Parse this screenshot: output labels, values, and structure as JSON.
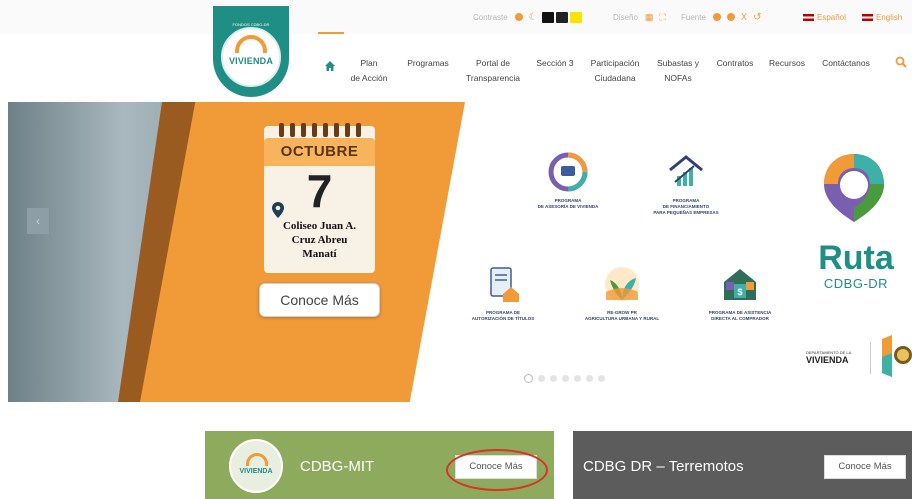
{
  "utility_bar": {
    "contrast_label": "Contraste",
    "design_label": "Diseño",
    "font_label": "Fuente",
    "spanish": "Español",
    "english": "English"
  },
  "logo": {
    "top_text": "FONDOS CDBG-DR",
    "word": "VIVIENDA"
  },
  "nav": {
    "items": [
      {
        "line1": "Plan",
        "line2": "de Acción"
      },
      {
        "line1": "Programas",
        "line2": ""
      },
      {
        "line1": "Portal de",
        "line2": "Transparencia"
      },
      {
        "line1": "Sección 3",
        "line2": ""
      },
      {
        "line1": "Participación",
        "line2": "Ciudadana"
      },
      {
        "line1": "Subastas y",
        "line2": "NOFAs"
      },
      {
        "line1": "Contratos",
        "line2": ""
      },
      {
        "line1": "Recursos",
        "line2": ""
      },
      {
        "line1": "Contáctanos",
        "line2": ""
      }
    ]
  },
  "hero": {
    "month": "OCTUBRE",
    "day": "7",
    "place_line1": "Coliseo Juan A.",
    "place_line2": "Cruz Abreu",
    "place_line3": "Manatí",
    "button": "Conoce Más",
    "programs": [
      {
        "l1": "PROGRAMA",
        "l2": "DE ASESORÍA DE VIVIENDA",
        "l3": ""
      },
      {
        "l1": "PROGRAMA",
        "l2": "DE FINANCIAMIENTO",
        "l3": "PARA PEQUEÑAS EMPRESAS"
      },
      {
        "l1": "PROGRAMA DE",
        "l2": "AUTORIZACIÓN DE TÍTULOS",
        "l3": ""
      },
      {
        "l1": "RE-GROW PR",
        "l2": "AGRICULTURA URBANA Y RURAL",
        "l3": ""
      },
      {
        "l1": "PROGRAMA DE ASISTENCIA",
        "l2": "DIRECTA AL COMPRADOR",
        "l3": ""
      }
    ],
    "ruta": "Ruta",
    "ruta_sub": "CDBG-DR",
    "dept_small": "DEPARTAMENTO DE LA",
    "dept_big": "VIVIENDA",
    "slides_total": 7,
    "slide_active": 1
  },
  "cards": [
    {
      "title": "CDBG-MIT",
      "button": "Conoce Más",
      "logo_word": "VIVIENDA"
    },
    {
      "title": "CDBG DR – Terremotos",
      "button": "Conoce Más"
    }
  ],
  "colors": {
    "teal": "#1f8e85",
    "orange": "#f19a38",
    "mit_green": "#8eaa5c",
    "dr_grey": "#5c5c5c",
    "highlight": "#d8322a"
  }
}
